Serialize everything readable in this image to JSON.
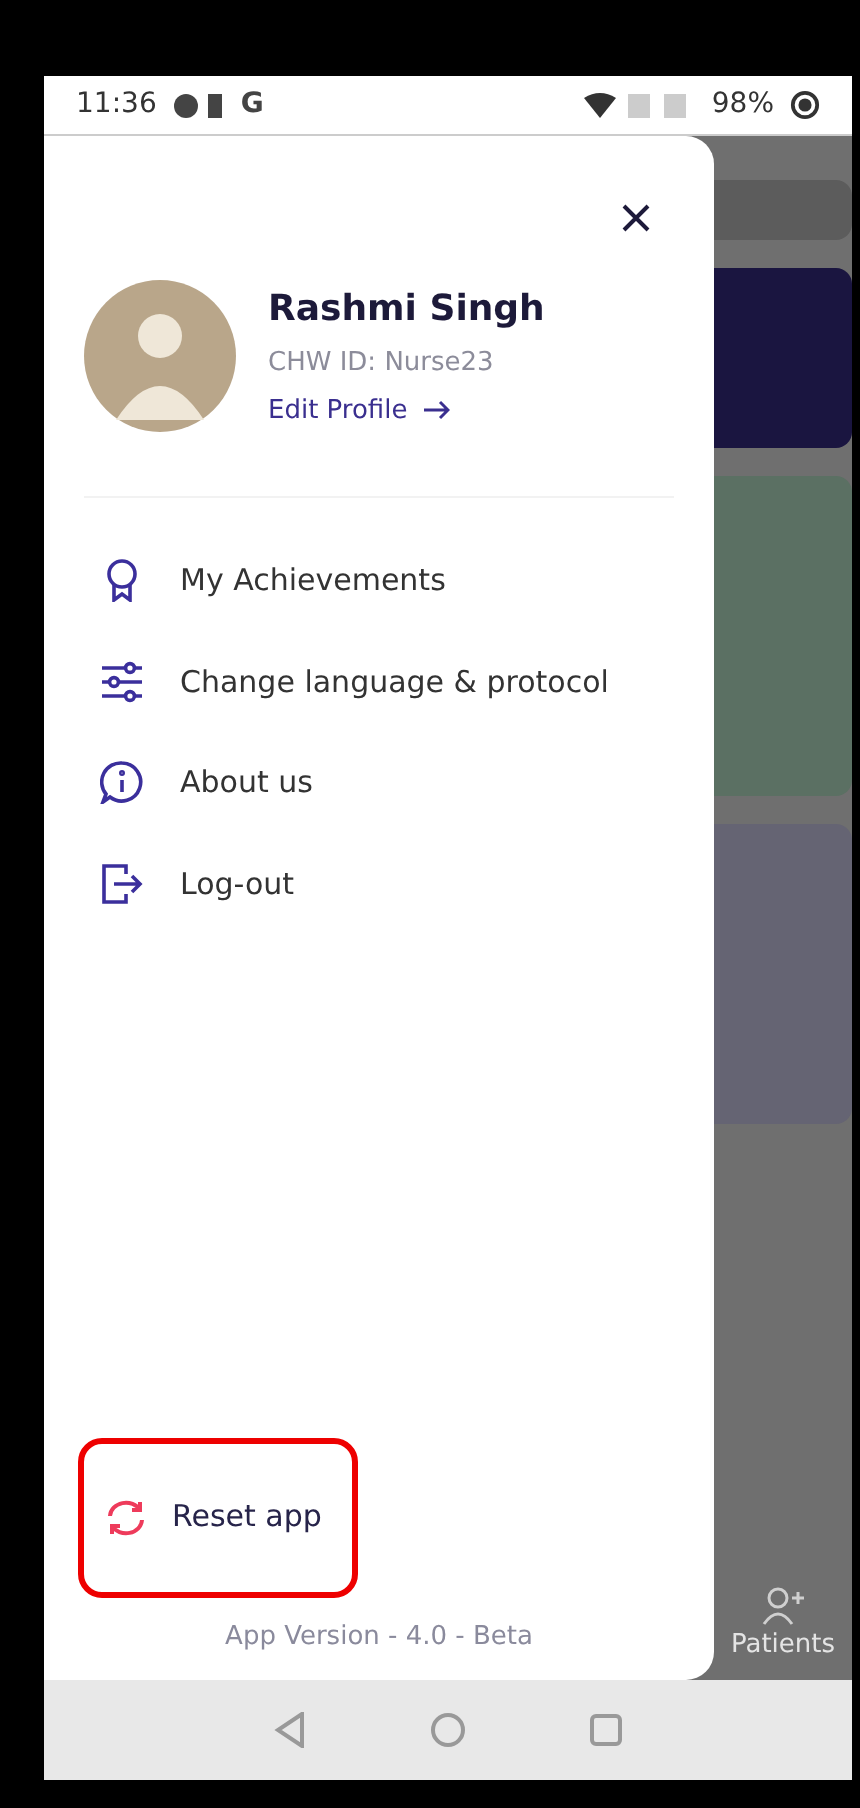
{
  "status_bar": {
    "time": "11:36",
    "notification_letter": "G",
    "battery": "98%"
  },
  "drawer": {
    "profile": {
      "name": "Rashmi Singh",
      "id_line": "CHW ID: Nurse23",
      "edit_link": "Edit Profile"
    },
    "menu": [
      {
        "kind": "award",
        "label": "My Achievements"
      },
      {
        "kind": "sliders",
        "label": "Change language & protocol"
      },
      {
        "kind": "info",
        "label": "About us"
      },
      {
        "kind": "logout",
        "label": "Log-out"
      }
    ],
    "reset": {
      "label": "Reset app",
      "highlighted": true
    },
    "version": "App Version - 4.0 - Beta"
  },
  "background": {
    "bottom_tab": "Patients"
  }
}
